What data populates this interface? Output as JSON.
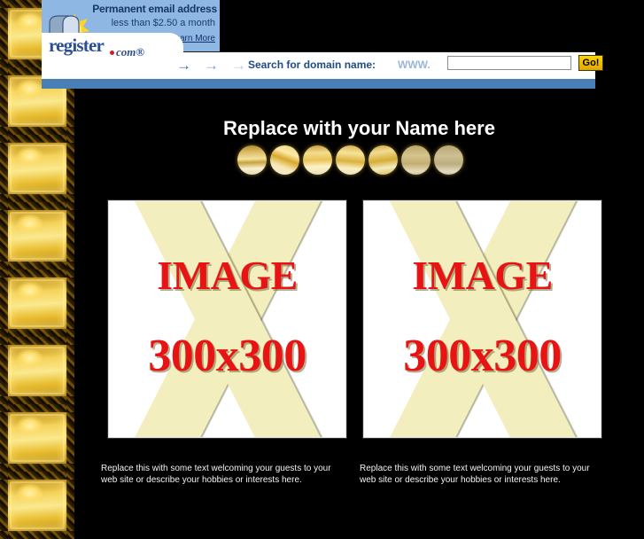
{
  "colors": {
    "background": "#000000",
    "banner_blue_bar": "#4a7fb5",
    "promo_panel": "#8fb7e3",
    "logo_blue": "#2b4f93",
    "placeholder_red": "#e81313",
    "placeholder_x": "#f2eebd",
    "go_button_yellow": "#ffd400",
    "gold": "#f3e2a0"
  },
  "ad": {
    "promo": {
      "title": "Permanent email address",
      "subtitle": "less than $2.50 a month",
      "link_label": "Learn More",
      "icon_name": "mailbox-icon"
    },
    "logo": {
      "register_text": "register",
      "com_text": "com®"
    },
    "arrows": [
      "→",
      "→",
      "→"
    ],
    "search": {
      "label": "Search for domain name:",
      "www_prefix": "WWW.",
      "input_value": "",
      "input_placeholder": "",
      "go_label": "Go!"
    }
  },
  "page": {
    "title": "Replace with your Name here"
  },
  "nav_bullets": [
    {
      "name": "nav-bullet-1"
    },
    {
      "name": "nav-bullet-2"
    },
    {
      "name": "nav-bullet-3"
    },
    {
      "name": "nav-bullet-4"
    },
    {
      "name": "nav-bullet-5"
    },
    {
      "name": "nav-bullet-6"
    },
    {
      "name": "nav-bullet-7"
    }
  ],
  "placeholders": [
    {
      "line1": "IMAGE",
      "line2": "300x300"
    },
    {
      "line1": "IMAGE",
      "line2": "300x300"
    }
  ],
  "captions": [
    "Replace this with some text welcoming your guests to your web site or describe your hobbies or interests here.",
    "Replace this with some text welcoming your guests to your web site or describe your hobbies or interests here."
  ],
  "sidebar": {
    "tile_count": 8,
    "tile_name": "decorative-gold-frame-tile"
  }
}
